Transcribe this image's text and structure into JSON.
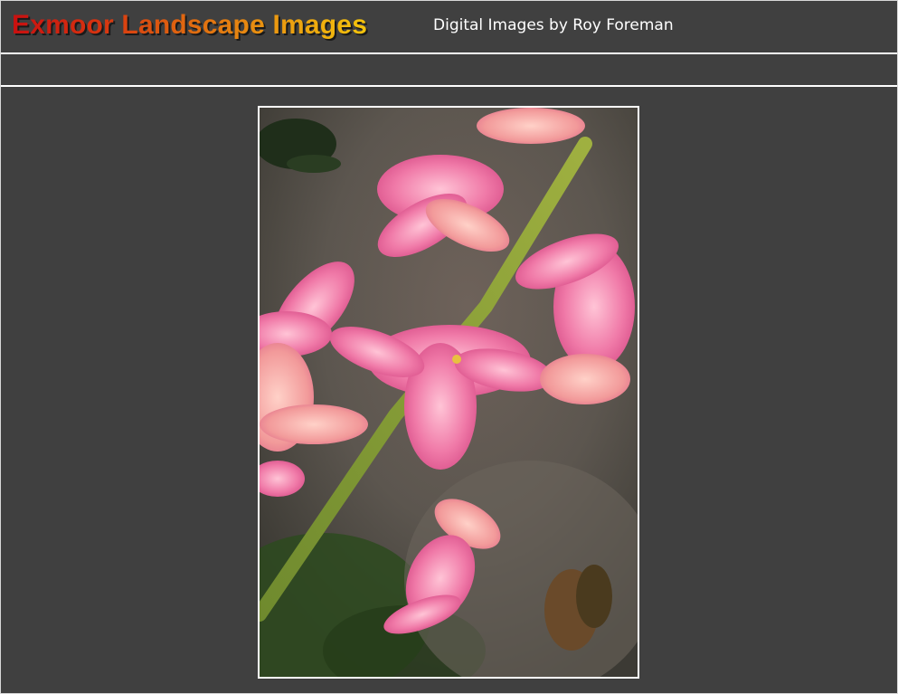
{
  "header": {
    "site_title": "Exmoor Landscape Images",
    "subtitle": "Digital Images by Roy Foreman"
  },
  "nav": {
    "items": []
  },
  "photo": {
    "subject": "pink hyacinth flowers",
    "border_color": "#ffffff"
  },
  "colors": {
    "background": "#404040",
    "rule": "#ffffff",
    "title_gradient_start": "#c81010",
    "title_gradient_end": "#f4c40c",
    "subtitle": "#ffffff"
  }
}
